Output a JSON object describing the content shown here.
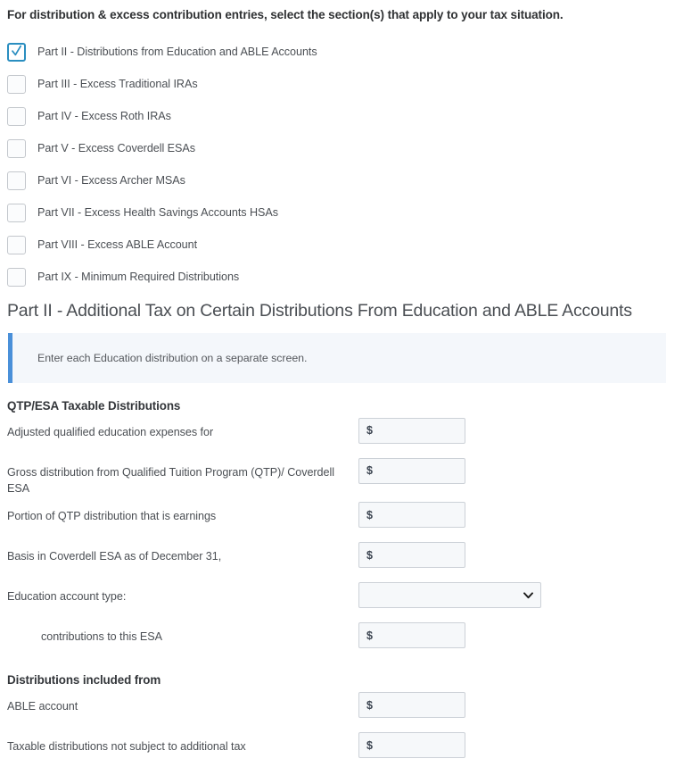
{
  "intro": {
    "text": "For distribution & excess contribution entries, select the section(s) that apply to your tax situation."
  },
  "section_checkboxes": [
    {
      "label": "Part II - Distributions from Education and ABLE Accounts",
      "checked": true
    },
    {
      "label": "Part III - Excess Traditional IRAs",
      "checked": false
    },
    {
      "label": "Part IV - Excess Roth IRAs",
      "checked": false
    },
    {
      "label": "Part V - Excess Coverdell ESAs",
      "checked": false
    },
    {
      "label": "Part VI - Excess Archer MSAs",
      "checked": false
    },
    {
      "label": "Part VII - Excess Health Savings Accounts HSAs",
      "checked": false
    },
    {
      "label": "Part VIII - Excess ABLE Account",
      "checked": false
    },
    {
      "label": "Part IX - Minimum Required Distributions",
      "checked": false
    }
  ],
  "part_heading": "Part II - Additional Tax on Certain Distributions From Education and ABLE Accounts",
  "info_banner": {
    "text": "Enter each Education distribution on a separate screen."
  },
  "qtp_section": {
    "title": "QTP/ESA Taxable Distributions",
    "fields": [
      {
        "label": "Adjusted qualified education expenses for",
        "type": "money",
        "value": "",
        "prefix": "$"
      },
      {
        "label": "Gross distribution from Qualified Tuition Program (QTP)/ Coverdell ESA",
        "type": "money",
        "value": "",
        "prefix": "$"
      },
      {
        "label": "Portion of QTP distribution that is earnings",
        "type": "money",
        "value": "",
        "prefix": "$"
      },
      {
        "label": "Basis in Coverdell ESA as of December 31,",
        "type": "money",
        "value": "",
        "prefix": "$"
      },
      {
        "label": "Education account type:",
        "type": "select",
        "value": "",
        "options": [
          ""
        ]
      },
      {
        "label": "contributions to this ESA",
        "type": "money",
        "value": "",
        "prefix": "$",
        "indent": true
      }
    ]
  },
  "distributions_section": {
    "title": "Distributions included from",
    "fields": [
      {
        "label": "ABLE account",
        "type": "money",
        "value": "",
        "prefix": "$"
      },
      {
        "label": "Taxable distributions not subject to additional tax",
        "type": "money",
        "value": "",
        "prefix": "$"
      }
    ]
  },
  "colors": {
    "accent_blue": "#4a90d9",
    "checkbox_checked_border": "#2a8ec0",
    "banner_background": "#f4f7fb",
    "input_background": "#f6f8fa",
    "input_border": "#ccd1d7",
    "text": "#4b4f54"
  }
}
